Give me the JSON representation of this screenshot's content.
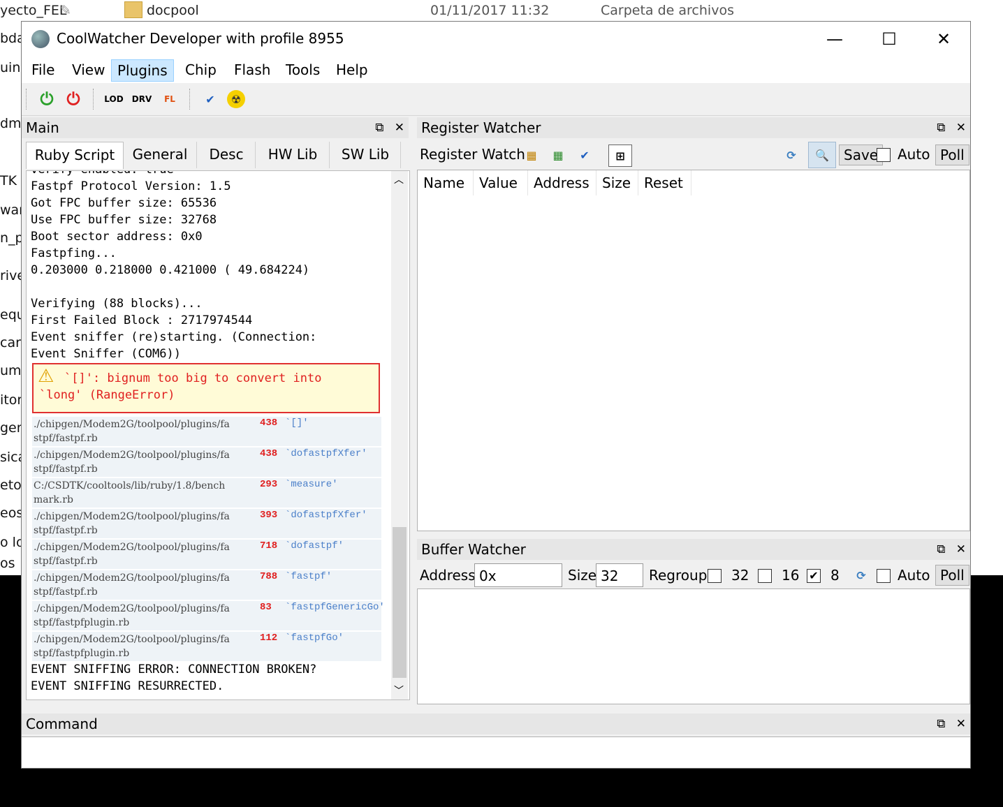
{
  "explorer": {
    "row_name": "docpool",
    "row_date": "01/11/2017 11:32",
    "row_type": "Carpeta de archivos",
    "left_top": "yecto_FEL",
    "left_items": [
      "bda",
      "uino",
      "",
      "dmi",
      "",
      "TK",
      "war",
      "n_pr",
      "rive",
      "equi",
      "carg",
      "umi",
      "itor",
      "gen",
      "sica",
      "etos",
      "eos",
      "o lo",
      "os"
    ]
  },
  "window": {
    "title": "CoolWatcher Developer with profile 8955",
    "minimize": "—",
    "maximize": "☐",
    "close": "✕"
  },
  "menu": [
    "File",
    "View",
    "Plugins",
    "Chip",
    "Flash",
    "Tools",
    "Help"
  ],
  "toolbar": {
    "power_on": "⏻",
    "power_off": "⏻",
    "lod_flash": "LOD",
    "drv_flash": "DRV",
    "burn": "FL",
    "tool": "✔",
    "radio": "☢"
  },
  "main": {
    "title": "Main",
    "float_icon": "⧉",
    "close_icon": "✕",
    "tabs": [
      "Ruby Script",
      "General",
      "Desc",
      "HW Lib",
      "SW Lib"
    ],
    "console_lines_top": [
      "verify enabled: true",
      "Fastpf Protocol Version: 1.5",
      "Got FPC buffer size: 65536",
      "Use FPC buffer size: 32768",
      "Boot sector address: 0x0",
      "Fastpfing...",
      "0.203000 0.218000 0.421000 ( 49.684224)",
      "",
      "Verifying (88 blocks)...",
      "First Failed Block : 2717974544",
      "Event sniffer (re)starting. (Connection:",
      "Event Sniffer (COM6))"
    ],
    "error": {
      "icon": "⚠",
      "line1": "`[]': bignum too big to convert into",
      "line2": "`long' (RangeError)"
    },
    "trace": [
      {
        "file": "./chipgen/Modem2G/toolpool/plugins/fa\nstpf/fastpf.rb",
        "line": "438",
        "method": "`[]'"
      },
      {
        "file": "./chipgen/Modem2G/toolpool/plugins/fa\nstpf/fastpf.rb",
        "line": "438",
        "method": "`dofastpfXfer'"
      },
      {
        "file": "C:/CSDTK/cooltools/lib/ruby/1.8/bench\nmark.rb",
        "line": "293",
        "method": "`measure'"
      },
      {
        "file": "./chipgen/Modem2G/toolpool/plugins/fa\nstpf/fastpf.rb",
        "line": "393",
        "method": "`dofastpfXfer'"
      },
      {
        "file": "./chipgen/Modem2G/toolpool/plugins/fa\nstpf/fastpf.rb",
        "line": "718",
        "method": "`dofastpf'"
      },
      {
        "file": "./chipgen/Modem2G/toolpool/plugins/fa\nstpf/fastpf.rb",
        "line": "788",
        "method": "`fastpf'"
      },
      {
        "file": "./chipgen/Modem2G/toolpool/plugins/fa\nstpf/fastpfplugin.rb",
        "line": "83",
        "method": "`fastpfGenericGo'"
      },
      {
        "file": "./chipgen/Modem2G/toolpool/plugins/fa\nstpf/fastpfplugin.rb",
        "line": "112",
        "method": "`fastpfGo'"
      }
    ],
    "console_lines_bottom": [
      "EVENT SNIFFING ERROR: CONNECTION BROKEN?",
      "EVENT SNIFFING RESURRECTED."
    ]
  },
  "register_watcher": {
    "title": "Register Watcher",
    "label": "Register Watch",
    "save": "Save",
    "auto": "Auto",
    "poll": "Poll",
    "columns": [
      "Name",
      "Value",
      "Address",
      "Size",
      "Reset"
    ]
  },
  "buffer_watcher": {
    "title": "Buffer Watcher",
    "address_label": "Address",
    "address_value": "0x",
    "size_label": "Size",
    "size_value": "32",
    "regroup_label": "Regroup",
    "opt32": "32",
    "opt16": "16",
    "opt8": "8",
    "auto": "Auto",
    "poll": "Poll",
    "checked_mark": "✔"
  },
  "command": {
    "title": "Command"
  }
}
